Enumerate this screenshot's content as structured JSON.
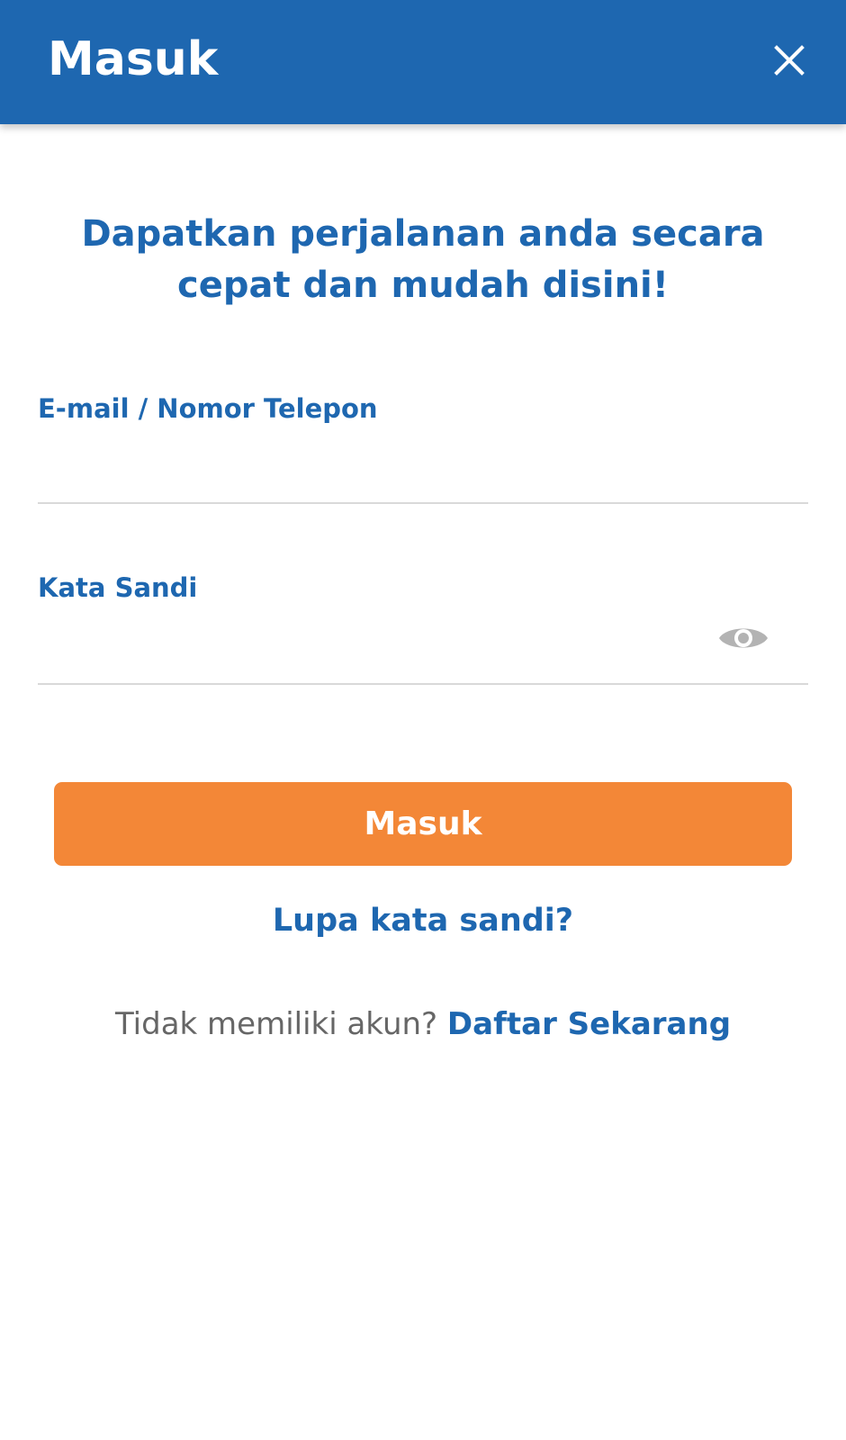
{
  "header": {
    "title": "Masuk",
    "close_icon": "close-icon"
  },
  "headline": {
    "line1": "Dapatkan perjalanan anda secara",
    "line2": "cepat dan mudah disini!"
  },
  "form": {
    "email_label": "E-mail / Nomor Telepon",
    "email_value": "",
    "password_label": "Kata Sandi",
    "password_value": "",
    "password_toggle_icon": "eye-icon",
    "submit_label": "Masuk"
  },
  "links": {
    "forgot_password": "Lupa kata sandi?",
    "register_prompt": "Tidak memiliki akun?",
    "register_link": "Daftar Sekarang"
  },
  "colors": {
    "primary": "#1e67b0",
    "accent": "#f38737",
    "divider": "#d9d9d9",
    "muted_text": "#666666",
    "icon_gray": "#b3b3b3"
  }
}
